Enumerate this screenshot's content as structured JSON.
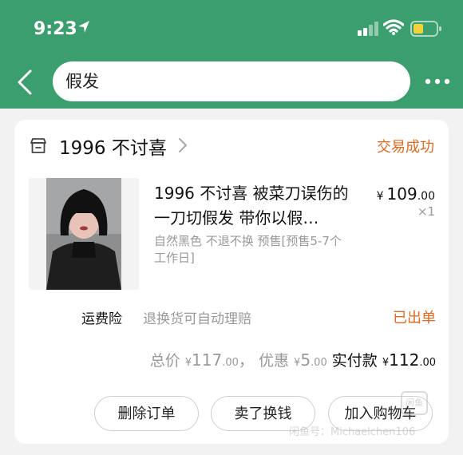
{
  "status_bar": {
    "time": "9:23"
  },
  "search": {
    "query": "假发"
  },
  "order": {
    "shop_name": "1996 不讨喜",
    "status": "交易成功",
    "product": {
      "title": "1996 不讨喜 被菜刀误伤的一刀切假发 带你以假…",
      "spec": "自然黑色 不退不换 预售[预售5-7个工作日]",
      "price_symbol": "¥",
      "price_int": "109",
      "price_dec": ".00",
      "quantity": "×1"
    },
    "insurance": {
      "label": "运费险",
      "desc": "退换货可自动理赔",
      "status": "已出单"
    },
    "totals": {
      "total_label": "总价",
      "total_int": "117",
      "total_dec": ".00",
      "separator": "，",
      "discount_label": "优惠",
      "discount_int": "5",
      "discount_dec": ".00",
      "paid_label": "实付款",
      "paid_int": "112",
      "paid_dec": ".00",
      "symbol": "¥"
    },
    "buttons": {
      "delete": "删除订单",
      "sell": "卖了换钱",
      "cart": "加入购物车"
    }
  },
  "watermark": {
    "text": "闲鱼号：Michaelchen106",
    "logo": "闲鱼"
  },
  "colors": {
    "topbar": "#3a9e6e",
    "accent_orange": "#e2681f"
  }
}
